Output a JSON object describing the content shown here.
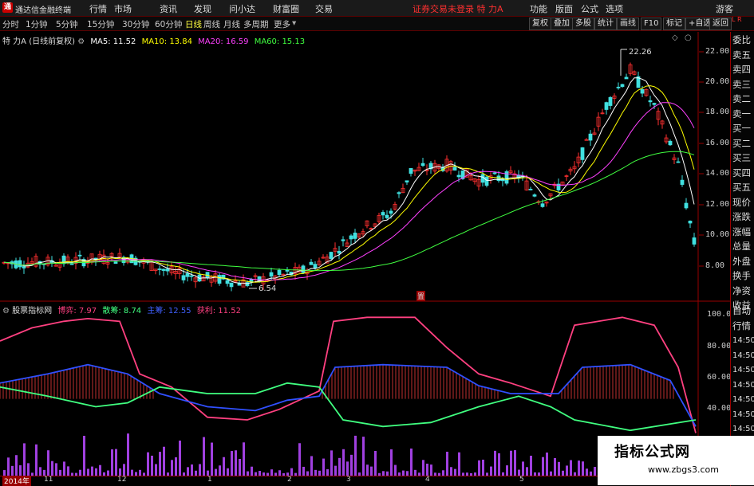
{
  "app": {
    "logo_glyph": "通",
    "title": "通达信金融终端"
  },
  "menu": [
    "行情",
    "市场",
    "资讯",
    "发现",
    "问小达",
    "财富圈",
    "交易"
  ],
  "notice": "证券交易未登录  特 力A",
  "right_menu": [
    "功能",
    "版面",
    "公式",
    "选项"
  ],
  "guest": "游客",
  "periods": [
    "分时",
    "1分钟",
    "5分钟",
    "15分钟",
    "30分钟",
    "60分钟",
    "日线",
    "周线",
    "月线",
    "多周期",
    "更多"
  ],
  "active_period": "日线",
  "toolbar": [
    "复权",
    "叠加",
    "多股",
    "统计",
    "画线",
    "F10",
    "标记",
    "+自选",
    "返回"
  ],
  "stock_header": {
    "name": "特 力A",
    "adj": "(日线前复权)"
  },
  "ma": [
    {
      "label": "MA5: 11.52",
      "color": "#ffffff"
    },
    {
      "label": "MA10: 13.84",
      "color": "#ffff00"
    },
    {
      "label": "MA20: 16.59",
      "color": "#ff40ff"
    },
    {
      "label": "MA60: 15.13",
      "color": "#40ff40"
    }
  ],
  "price_axis": [
    "22.00",
    "20.00",
    "18.00",
    "16.00",
    "14.00",
    "12.00",
    "10.00",
    "8.00"
  ],
  "annotations": {
    "high": "22.26",
    "low": "6.54",
    "center_tag": "置"
  },
  "indicator_header": {
    "name": "股票指标网",
    "items": [
      {
        "label": "博弈: 7.97",
        "color": "#ff4080"
      },
      {
        "label": "散筹: 8.74",
        "color": "#40ff80"
      },
      {
        "label": "主筹: 12.55",
        "color": "#4060ff"
      },
      {
        "label": "获利: 11.52",
        "color": "#ff4080"
      }
    ]
  },
  "indicator_axis": [
    "100.00",
    "80.00",
    "60.00",
    "40.00"
  ],
  "side_items": [
    "委比",
    "卖五",
    "卖四",
    "卖三",
    "卖二",
    "卖一",
    "买一",
    "买二",
    "买三",
    "买四",
    "买五",
    "现价",
    "涨跌",
    "涨幅",
    "总量",
    "外盘",
    "换手",
    "净资",
    "收益"
  ],
  "side_lower": [
    "自动",
    "行情",
    "14:50",
    "14:50",
    "14:50",
    "14:50",
    "14:50",
    "14:50",
    "14:50",
    "14:50"
  ],
  "dates": [
    "2014年",
    "11",
    "12",
    "1",
    "2",
    "3",
    "4",
    "5"
  ],
  "watermark": {
    "title": "指标公式网",
    "url": "www.zbgs3.com"
  },
  "colors": {
    "up": "#ff3030",
    "down": "#40e0e0",
    "ma5": "#ffffff",
    "ma10": "#ffff00",
    "ma20": "#ff40ff",
    "ma60": "#40ff40"
  }
}
